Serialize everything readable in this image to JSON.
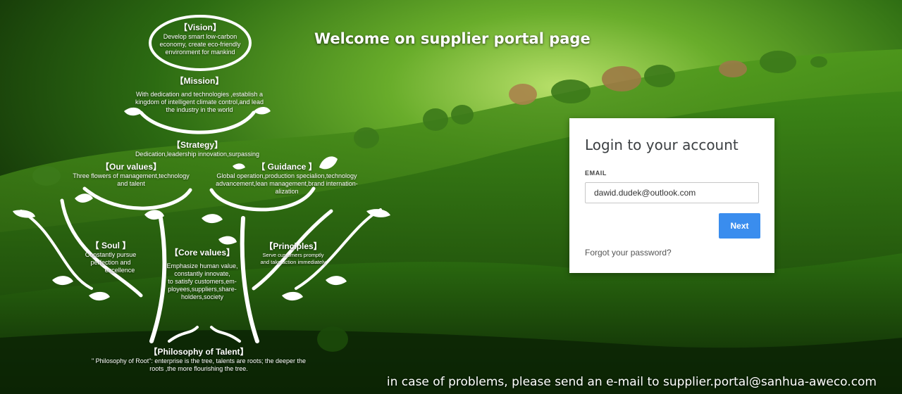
{
  "header": {
    "welcome": "Welcome on supplier portal page"
  },
  "tree": {
    "vision": {
      "title": "【Vision】",
      "lines": [
        "Develop  smart low-carbon",
        "economy, create eco-friendly",
        "environment for mankind"
      ]
    },
    "mission": {
      "title": "【Mission】",
      "lines": [
        "With dedication and technologies ,establish a",
        "kingdom of intelligent climate control,and lead",
        "the industry in the world"
      ]
    },
    "strategy": {
      "title": "【Strategy】",
      "text": "Dedication,leadership innovation,surpassing"
    },
    "our_values": {
      "title": "【Our values】",
      "lines": [
        "Three flowers of management,technology",
        "and talent"
      ]
    },
    "guidance": {
      "title": "【  Guidance 】",
      "lines": [
        "Global operation,production specialion,technology",
        "advancement,lean management,brand internation-",
        "alization"
      ]
    },
    "soul": {
      "title": "【 Soul 】",
      "lines": [
        "Constantly pursue",
        "perfection and",
        "excellence"
      ]
    },
    "core_values": {
      "title": "【Core values】",
      "lines": [
        "Emphasize human value,",
        "constantly innovate,",
        "to satisfy    customers,em-",
        "ployees,suppliers,share-",
        "holders,society"
      ]
    },
    "principles": {
      "title": "【Principles】",
      "lines": [
        "Serve customers promptly",
        "and take action immediately"
      ]
    },
    "philosophy": {
      "title": "【Philosophy of Talent】",
      "lines": [
        "\" Philosophy of Root\": enterprise is the tree, talents are roots; the deeper the",
        "roots ,the more flourishing the tree."
      ]
    }
  },
  "login": {
    "title": "Login to your account",
    "email_label": "EMAIL",
    "email_value": "dawid.dudek@outlook.com",
    "next_label": "Next",
    "forgot_label": "Forgot your password?"
  },
  "footer": {
    "text": "in case of problems, please send an e-mail to supplier.portal@sanhua-aweco.com"
  },
  "colors": {
    "primary_button": "#3a8dee",
    "card_bg": "#ffffff",
    "bg_green": "#2f6a14"
  }
}
